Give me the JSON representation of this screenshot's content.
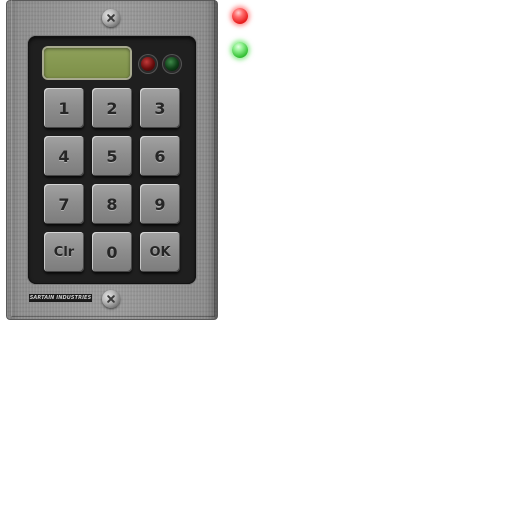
{
  "keypad": {
    "display_value": "",
    "keys": [
      {
        "label": "1",
        "name": "key-1"
      },
      {
        "label": "2",
        "name": "key-2"
      },
      {
        "label": "3",
        "name": "key-3"
      },
      {
        "label": "4",
        "name": "key-4"
      },
      {
        "label": "5",
        "name": "key-5"
      },
      {
        "label": "6",
        "name": "key-6"
      },
      {
        "label": "7",
        "name": "key-7"
      },
      {
        "label": "8",
        "name": "key-8"
      },
      {
        "label": "9",
        "name": "key-9"
      },
      {
        "label": "Clr",
        "name": "key-clear"
      },
      {
        "label": "0",
        "name": "key-0"
      },
      {
        "label": "OK",
        "name": "key-ok"
      }
    ],
    "brand": "SARTAIN INDUSTRIES",
    "indicators": {
      "red": {
        "color": "#e81e1e"
      },
      "green": {
        "color": "#35c035"
      }
    }
  },
  "status_lights": [
    {
      "name": "status-led-red",
      "color": "#ff3c3c"
    },
    {
      "name": "status-led-green",
      "color": "#3cdc3c"
    }
  ],
  "colors": {
    "plate": "#9a9a9a",
    "panel": "#1f1f1f",
    "lcd": "#8ea05a",
    "key": "#8e8e8e"
  }
}
